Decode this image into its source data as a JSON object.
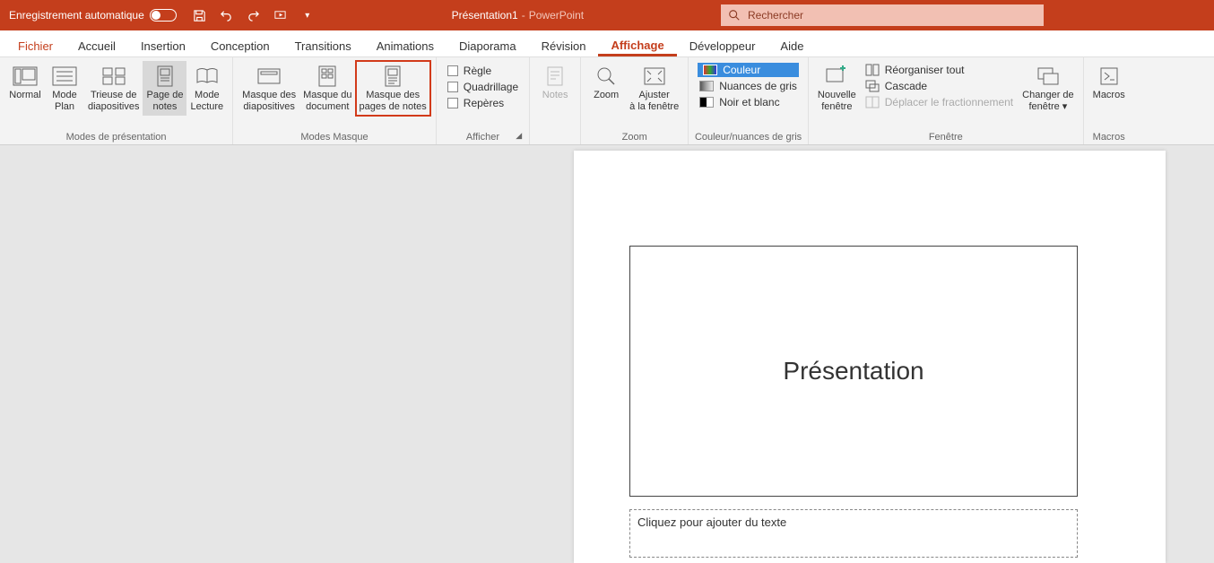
{
  "titlebar": {
    "autosave": "Enregistrement automatique",
    "doc": "Présentation1",
    "sep": "-",
    "app": "PowerPoint",
    "search_placeholder": "Rechercher"
  },
  "tabs": {
    "file": "Fichier",
    "home": "Accueil",
    "insert": "Insertion",
    "design": "Conception",
    "transitions": "Transitions",
    "animations": "Animations",
    "slideshow": "Diaporama",
    "review": "Révision",
    "view": "Affichage",
    "developer": "Développeur",
    "help": "Aide"
  },
  "ribbon": {
    "presentation_views": {
      "normal": "Normal",
      "outline": "Mode\nPlan",
      "sorter": "Trieuse de\ndiapositives",
      "notes_page": "Page de\nnotes",
      "reading": "Mode\nLecture",
      "label": "Modes de présentation"
    },
    "master_views": {
      "slide_master": "Masque des\ndiapositives",
      "handout_master": "Masque du\ndocument",
      "notes_master": "Masque des\npages de notes",
      "label": "Modes Masque"
    },
    "show": {
      "ruler": "Règle",
      "gridlines": "Quadrillage",
      "guides": "Repères",
      "label": "Afficher"
    },
    "notes": {
      "btn": "Notes"
    },
    "zoom": {
      "zoom": "Zoom",
      "fit": "Ajuster\nà la fenêtre",
      "label": "Zoom"
    },
    "color": {
      "color": "Couleur",
      "gray": "Nuances de gris",
      "bw": "Noir et blanc",
      "label": "Couleur/nuances de gris"
    },
    "window": {
      "new": "Nouvelle\nfenêtre",
      "arrange": "Réorganiser tout",
      "cascade": "Cascade",
      "split": "Déplacer le fractionnement",
      "label": "Fenêtre"
    },
    "switch": {
      "btn": "Changer de\nfenêtre ▾"
    },
    "macros": {
      "btn": "Macros",
      "label": "Macros"
    }
  },
  "slide": {
    "title": "Présentation",
    "notes_placeholder": "Cliquez pour ajouter du texte"
  }
}
